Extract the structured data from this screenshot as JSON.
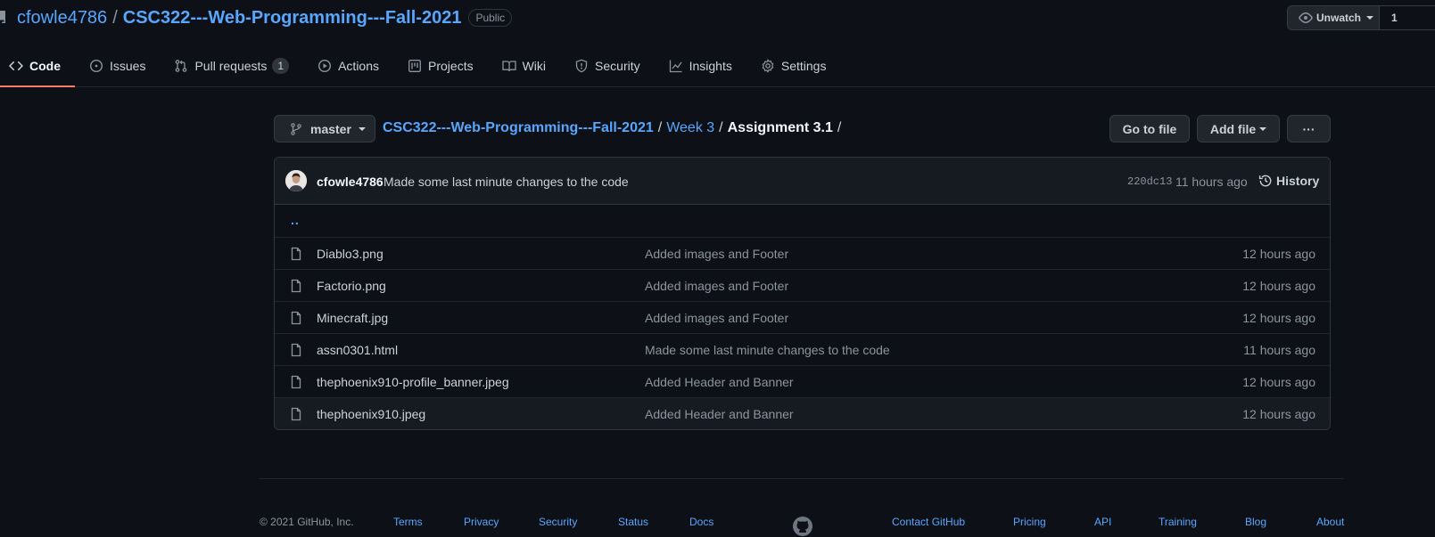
{
  "repo": {
    "owner": "cfowle4786",
    "separator": "/",
    "name": "CSC322---Web-Programming---Fall-2021",
    "visibility": "Public",
    "watch": {
      "label": "Unwatch",
      "count": "1"
    }
  },
  "tabs": [
    {
      "label": "Code",
      "icon": "code-icon",
      "active": true
    },
    {
      "label": "Issues",
      "icon": "issue-icon"
    },
    {
      "label": "Pull requests",
      "icon": "pull-request-icon",
      "count": "1"
    },
    {
      "label": "Actions",
      "icon": "play-icon"
    },
    {
      "label": "Projects",
      "icon": "project-icon"
    },
    {
      "label": "Wiki",
      "icon": "book-icon"
    },
    {
      "label": "Security",
      "icon": "shield-icon"
    },
    {
      "label": "Insights",
      "icon": "graph-icon"
    },
    {
      "label": "Settings",
      "icon": "gear-icon"
    }
  ],
  "file_nav": {
    "branch": "master",
    "breadcrumb": {
      "root": "CSC322---Web-Programming---Fall-2021",
      "folder": "Week 3",
      "current": "Assignment 3.1",
      "slash": "/"
    },
    "goto_file": "Go to file",
    "add_file": "Add file",
    "more": "···"
  },
  "latest_commit": {
    "author": "cfowle4786",
    "message": "Made some last minute changes to the code",
    "sha": "220dc13",
    "age": "11 hours ago",
    "history_label": "History"
  },
  "parent_dir": "..",
  "files": [
    {
      "name": "Diablo3.png",
      "message": "Added images and Footer",
      "age": "12 hours ago"
    },
    {
      "name": "Factorio.png",
      "message": "Added images and Footer",
      "age": "12 hours ago"
    },
    {
      "name": "Minecraft.jpg",
      "message": "Added images and Footer",
      "age": "12 hours ago"
    },
    {
      "name": "assn0301.html",
      "message": "Made some last minute changes to the code",
      "age": "11 hours ago"
    },
    {
      "name": "thephoenix910-profile_banner.jpeg",
      "message": "Added Header and Banner",
      "age": "12 hours ago"
    },
    {
      "name": "thephoenix910.jpeg",
      "message": "Added Header and Banner",
      "age": "12 hours ago"
    }
  ],
  "footer": {
    "copyright": "© 2021 GitHub, Inc.",
    "links_left": [
      "Terms",
      "Privacy",
      "Security",
      "Status",
      "Docs"
    ],
    "links_right": [
      "Contact GitHub",
      "Pricing",
      "API",
      "Training",
      "Blog",
      "About"
    ]
  },
  "colors": {
    "background": "#0d1117",
    "link": "#58a6ff",
    "active_tab_underline": "#f78166",
    "border": "#30363d"
  }
}
